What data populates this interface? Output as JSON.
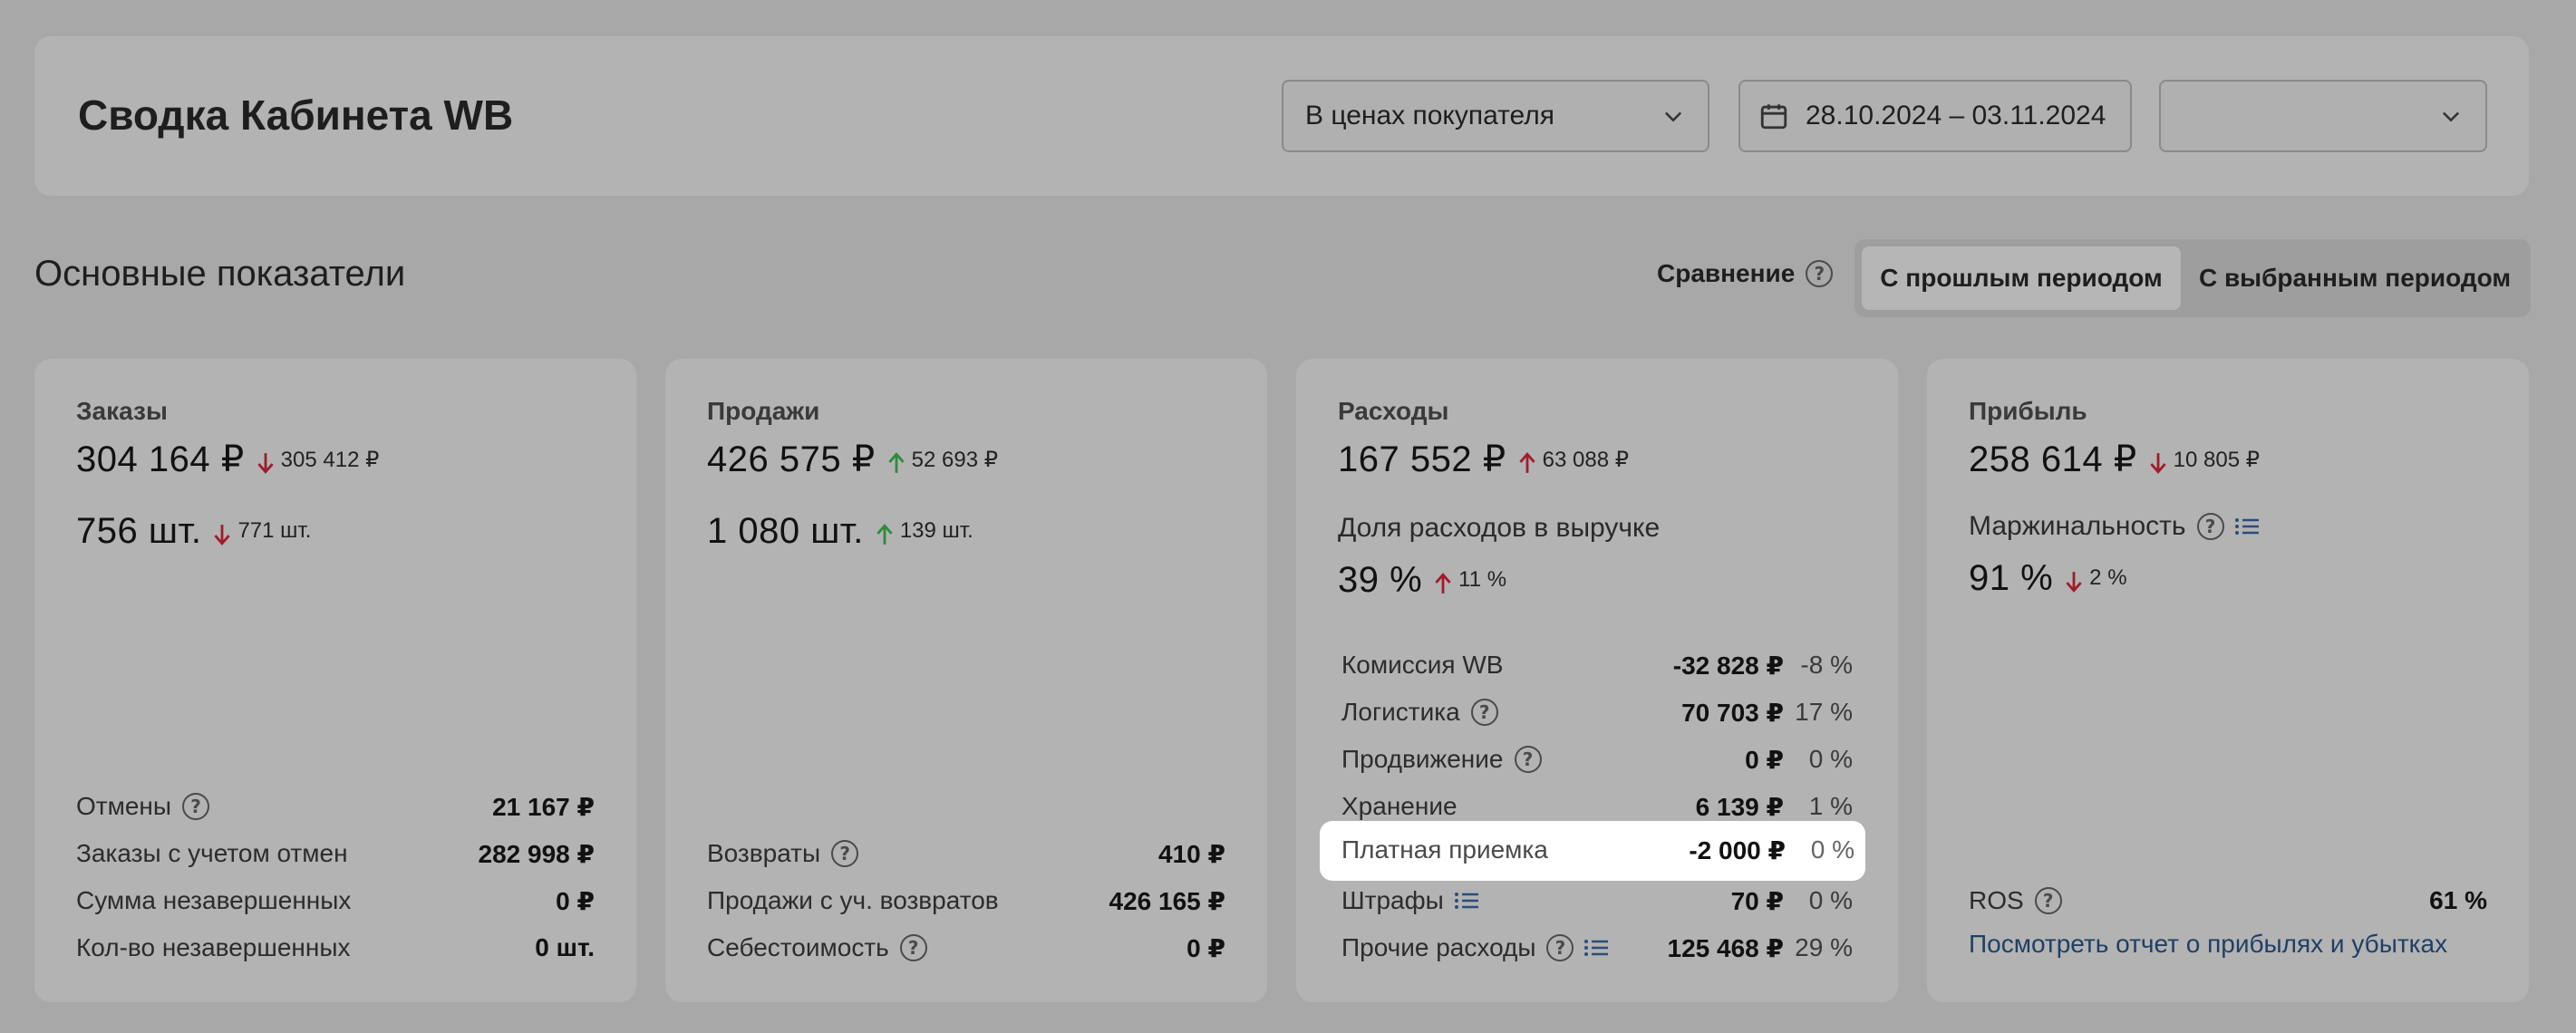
{
  "header": {
    "title": "Сводка Кабинета WB",
    "price_select": "В ценах покупателя",
    "date_range": "28.10.2024 – 03.11.2024",
    "extra_select": ""
  },
  "section": {
    "title": "Основные показатели",
    "compare_label": "Сравнение",
    "compare_options": [
      "С прошлым периодом",
      "С выбранным периодом"
    ],
    "compare_active": "С прошлым периодом"
  },
  "colors": {
    "up": "#2e8b3e",
    "down": "#a01c2c"
  },
  "orders": {
    "label": "Заказы",
    "sum": "304 164 ₽",
    "sum_delta": "305 412 ₽",
    "sum_dir": "down",
    "qty": "756 шт.",
    "qty_delta": "771 шт.",
    "qty_dir": "down",
    "rows": [
      {
        "label": "Отмены",
        "value": "21 167 ₽",
        "help": true
      },
      {
        "label": "Заказы с учетом отмен",
        "value": "282 998 ₽"
      },
      {
        "label": "Сумма незавершенных",
        "value": "0 ₽"
      },
      {
        "label": "Кол-во незавершенных",
        "value": "0 шт."
      }
    ]
  },
  "sales": {
    "label": "Продажи",
    "sum": "426 575 ₽",
    "sum_delta": "52 693 ₽",
    "sum_dir": "up",
    "qty": "1 080 шт.",
    "qty_delta": "139 шт.",
    "qty_dir": "up",
    "rows": [
      {
        "label": "Возвраты",
        "value": "410 ₽",
        "help": true
      },
      {
        "label": "Продажи с уч. возвратов",
        "value": "426 165 ₽"
      },
      {
        "label": "Себестоимость",
        "value": "0 ₽",
        "help": true
      }
    ]
  },
  "expenses": {
    "label": "Расходы",
    "sum": "167 552 ₽",
    "sum_delta": "63 088 ₽",
    "sum_dir": "up",
    "share_label": "Доля расходов в выручке",
    "share": "39 %",
    "share_delta": "11 %",
    "share_dir": "up",
    "rows": [
      {
        "label": "Комиссия WB",
        "value": "-32 828 ₽",
        "pct": "-8 %"
      },
      {
        "label": "Логистика",
        "value": "70 703 ₽",
        "pct": "17 %",
        "help": true
      },
      {
        "label": "Продвижение",
        "value": "0 ₽",
        "pct": "0 %",
        "help": true
      },
      {
        "label": "Хранение",
        "value": "6 139 ₽",
        "pct": "1 %"
      },
      {
        "label": "Платная приемка",
        "value": "-2 000 ₽",
        "pct": "0 %"
      },
      {
        "label": "Штрафы",
        "value": "70 ₽",
        "pct": "0 %",
        "list": true
      },
      {
        "label": "Прочие расходы",
        "value": "125 468 ₽",
        "pct": "29 %",
        "help": true,
        "list": true
      }
    ]
  },
  "profit": {
    "label": "Прибыль",
    "sum": "258 614 ₽",
    "sum_delta": "10 805 ₽",
    "sum_dir": "down",
    "margin_label": "Маржинальность",
    "margin": "91 %",
    "margin_delta": "2 %",
    "margin_dir": "down",
    "ros_label": "ROS",
    "ros_value": "61 %",
    "report_link": "Посмотреть отчет о прибылях и убытках"
  }
}
